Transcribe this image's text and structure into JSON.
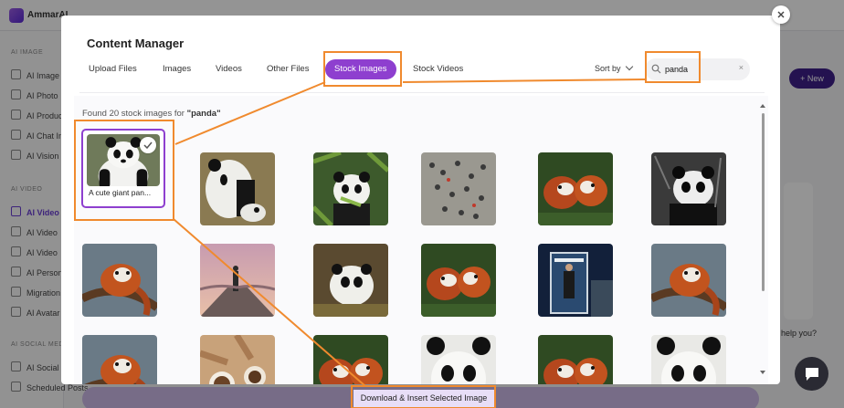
{
  "app": {
    "brand": "AmmarAI"
  },
  "background": {
    "sidebar_sections": [
      {
        "title": "AI IMAGE",
        "items": [
          "AI Image",
          "AI Photo",
          "AI Produc",
          "AI Chat Im",
          "AI Vision"
        ]
      },
      {
        "title": "AI VIDEO",
        "items": [
          "AI Video",
          "AI Video",
          "AI Video",
          "AI Person",
          "Migration",
          "AI Avatar"
        ]
      },
      {
        "title": "AI SOCIAL MEDI",
        "items": [
          "AI Social",
          "Scheduled Posts"
        ]
      }
    ],
    "new_button": "+ New",
    "help_text": "help you?"
  },
  "modal": {
    "title": "Content Manager",
    "tabs": [
      {
        "label": "Upload Files",
        "active": false
      },
      {
        "label": "Images",
        "active": false
      },
      {
        "label": "Videos",
        "active": false
      },
      {
        "label": "Other Files",
        "active": false
      },
      {
        "label": "Stock Images",
        "active": true
      },
      {
        "label": "Stock Videos",
        "active": false
      }
    ],
    "sort_label": "Sort by",
    "search": {
      "value": "panda",
      "clear_icon": "×"
    },
    "found_prefix": "Found 20 stock images for ",
    "found_query": "\"panda\"",
    "insert_button": "Download & Insert Selected Image",
    "images": [
      {
        "caption": "A cute giant pan...",
        "selected": true,
        "theme": "panda"
      },
      {
        "caption": "",
        "selected": false,
        "theme": "panda-cub"
      },
      {
        "caption": "",
        "selected": false,
        "theme": "panda-bamboo"
      },
      {
        "caption": "",
        "selected": false,
        "theme": "crowd"
      },
      {
        "caption": "",
        "selected": false,
        "theme": "red-panda"
      },
      {
        "caption": "",
        "selected": false,
        "theme": "panda-bw"
      },
      {
        "caption": "",
        "selected": false,
        "theme": "red-panda-tree"
      },
      {
        "caption": "",
        "selected": false,
        "theme": "person-road"
      },
      {
        "caption": "",
        "selected": false,
        "theme": "panda-grass"
      },
      {
        "caption": "",
        "selected": false,
        "theme": "red-panda"
      },
      {
        "caption": "",
        "selected": false,
        "theme": "phone-booth"
      },
      {
        "caption": "",
        "selected": false,
        "theme": "red-panda-tree"
      },
      {
        "caption": "",
        "selected": false,
        "theme": "red-panda-tree"
      },
      {
        "caption": "",
        "selected": false,
        "theme": "coffee"
      },
      {
        "caption": "",
        "selected": false,
        "theme": "red-panda"
      },
      {
        "caption": "",
        "selected": false,
        "theme": "panda-face"
      },
      {
        "caption": "",
        "selected": false,
        "theme": "red-panda"
      },
      {
        "caption": "",
        "selected": false,
        "theme": "panda-face"
      }
    ]
  },
  "colors": {
    "accent": "#8e3fcf",
    "annotation": "#f08a2e"
  }
}
